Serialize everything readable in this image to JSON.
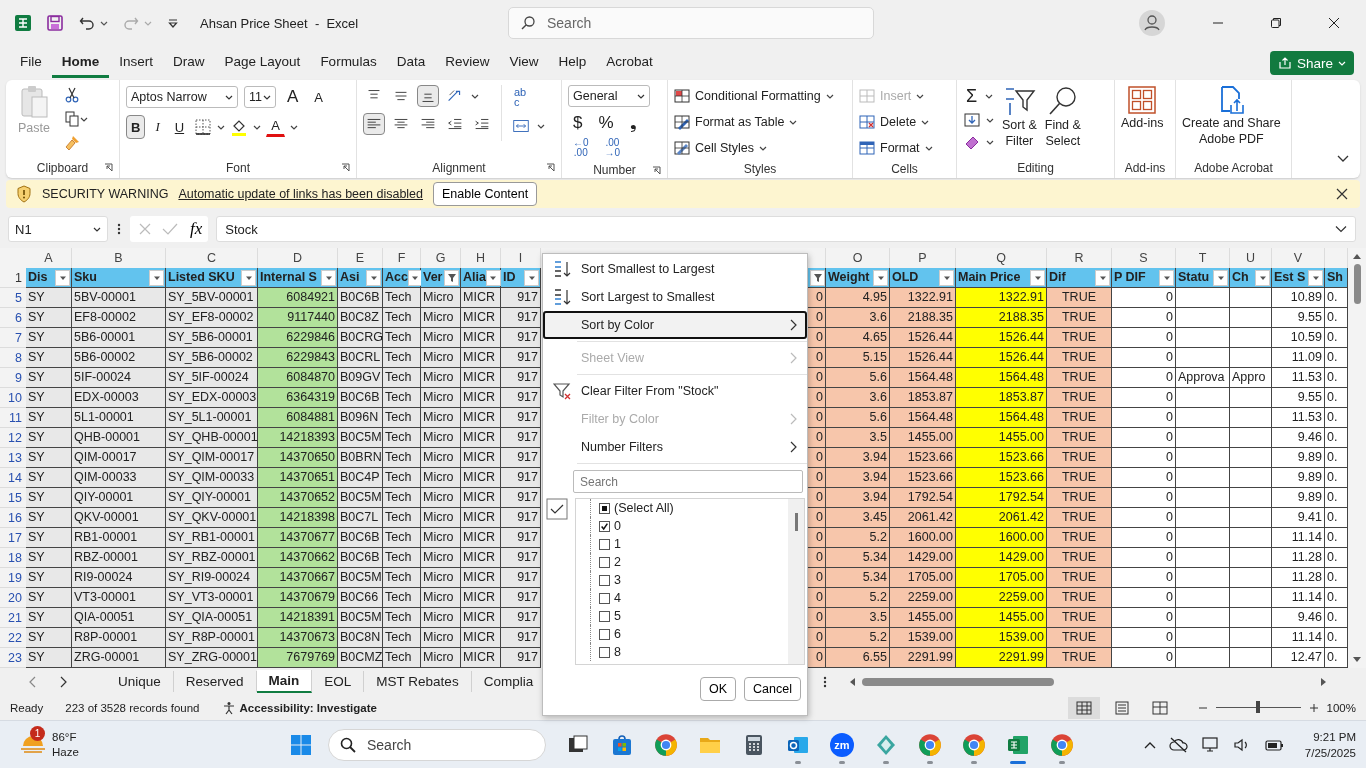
{
  "window": {
    "title": "Ahsan Price Sheet  -  Excel",
    "search_placeholder": "Search"
  },
  "ribbon_tabs": [
    {
      "label": "File",
      "selected": false
    },
    {
      "label": "Home",
      "selected": true
    },
    {
      "label": "Insert",
      "selected": false
    },
    {
      "label": "Draw",
      "selected": false
    },
    {
      "label": "Page Layout",
      "selected": false
    },
    {
      "label": "Formulas",
      "selected": false
    },
    {
      "label": "Data",
      "selected": false
    },
    {
      "label": "Review",
      "selected": false
    },
    {
      "label": "View",
      "selected": false
    },
    {
      "label": "Help",
      "selected": false
    },
    {
      "label": "Acrobat",
      "selected": false
    }
  ],
  "share_button": "Share",
  "clipboard": {
    "paste": "Paste",
    "label": "Clipboard"
  },
  "font": {
    "family": "Aptos Narrow",
    "size": "11",
    "grow": "A",
    "shrink": "A",
    "styles": [
      {
        "label": "B",
        "kind": "bold",
        "on": true
      },
      {
        "label": "I",
        "kind": "italic",
        "on": false
      },
      {
        "label": "U",
        "kind": "underline",
        "on": false
      }
    ],
    "font_color": "A",
    "label": "Font"
  },
  "alignment": {
    "vertical": [
      {
        "kind": "top",
        "on": false
      },
      {
        "kind": "middle",
        "on": false
      },
      {
        "kind": "bottom",
        "on": true
      }
    ],
    "horizontal": [
      {
        "kind": "left",
        "on": true
      },
      {
        "kind": "center",
        "on": false
      },
      {
        "kind": "right",
        "on": false
      }
    ],
    "wrap_top": "ab",
    "wrap_bottom": "c",
    "label": "Alignment"
  },
  "number": {
    "format": "General",
    "symbols": [
      "$",
      "%",
      "❟"
    ],
    "decimals": [
      {
        "top": "←0",
        "bottom": ".00"
      },
      {
        "top": ".00",
        "bottom": "→0"
      }
    ],
    "label": "Number"
  },
  "styles": {
    "items": [
      {
        "label": "Conditional Formatting",
        "kind": "conditional"
      },
      {
        "label": "Format as Table",
        "kind": "table"
      },
      {
        "label": "Cell Styles",
        "kind": "cell"
      }
    ],
    "label": "Styles"
  },
  "cells": {
    "items": [
      {
        "label": "Insert",
        "kind": "insert",
        "disabled": true
      },
      {
        "label": "Delete",
        "kind": "delete",
        "disabled": false
      },
      {
        "label": "Format",
        "kind": "format",
        "disabled": false
      }
    ],
    "label": "Cells"
  },
  "editing": {
    "autosum": "Σ",
    "sort_filter": [
      "Sort &",
      "Filter"
    ],
    "find_select": [
      "Find &",
      "Select"
    ],
    "label": "Editing"
  },
  "addins": {
    "button": "Add-ins",
    "label": "Add-ins"
  },
  "acrobat": {
    "button": [
      "Create and Share",
      "Adobe PDF"
    ],
    "label": "Adobe Acrobat"
  },
  "security_bar": {
    "title": "SECURITY WARNING",
    "message": "Automatic update of links has been disabled",
    "button": "Enable Content"
  },
  "formula_bar": {
    "name_box": "N1",
    "fx": "fx",
    "value": "Stock"
  },
  "sheet": {
    "header_row_number": "1",
    "columns": [
      {
        "letter": "A",
        "header": "Dis",
        "kind": "text",
        "color": "#e8e8e8",
        "filtered": false
      },
      {
        "letter": "B",
        "header": "Sku",
        "kind": "text",
        "color": "#e8e8e8",
        "filtered": false
      },
      {
        "letter": "C",
        "header": "Listed SKU",
        "kind": "text",
        "color": "#e8e8e8",
        "filtered": false
      },
      {
        "letter": "D",
        "header": "Internal S",
        "kind": "number",
        "color": "#b2e29b",
        "filtered": false
      },
      {
        "letter": "E",
        "header": "Asi",
        "kind": "text",
        "color": "#e8e8e8",
        "filtered": false
      },
      {
        "letter": "F",
        "header": "Acc",
        "kind": "text",
        "color": "#e8e8e8",
        "filtered": false
      },
      {
        "letter": "G",
        "header": "Ver",
        "kind": "text",
        "color": "#e8e8e8",
        "filtered": true
      },
      {
        "letter": "H",
        "header": "Alia",
        "kind": "text",
        "color": "#e8e8e8",
        "filtered": false
      },
      {
        "letter": "I",
        "header": "ID",
        "kind": "number",
        "color": "#e8e8e8",
        "filtered": false
      },
      {
        "kind": "number",
        "color": "#f7c6ab",
        "filtered": true
      },
      {
        "letter": "O",
        "header": "Weight",
        "kind": "number",
        "color": "#f7c6ab",
        "filtered": false
      },
      {
        "letter": "P",
        "header": "OLD",
        "kind": "number",
        "color": "#f7c6ab",
        "filtered": false
      },
      {
        "letter": "Q",
        "header": "Main Price",
        "kind": "number",
        "color": "#ffff00",
        "filtered": false
      },
      {
        "letter": "R",
        "header": "Dif",
        "kind": "bool",
        "color": "#f7c6ab",
        "filtered": false
      },
      {
        "letter": "S",
        "header": "P DIF",
        "kind": "number",
        "color": "#ffffff",
        "filtered": false
      },
      {
        "letter": "T",
        "header": "Statu",
        "kind": "text",
        "color": "#ffffff",
        "filtered": false
      },
      {
        "letter": "U",
        "header": "Ch",
        "kind": "text",
        "color": "#ffffff",
        "filtered": false
      },
      {
        "letter": "V",
        "header": "Est S",
        "kind": "number",
        "color": "#ffffff",
        "filtered": false
      },
      {
        "header": "Sh",
        "kind": "text",
        "color": "#ffffff"
      }
    ],
    "rows": [
      {
        "number": "5",
        "cells": [
          "SY",
          "5BV-00001",
          "SY_5BV-00001",
          "6084921",
          "B0C6B",
          "Tech",
          "Micro",
          "MICR",
          "917",
          "0",
          "4.95",
          "1322.91",
          "1322.91",
          "TRUE",
          "0",
          null,
          null,
          "10.89",
          "0."
        ]
      },
      {
        "number": "6",
        "cells": [
          "SY",
          "EF8-00002",
          "SY_EF8-00002",
          "9117440",
          "B0C8Z",
          "Tech",
          "Micro",
          "MICR",
          "917",
          "0",
          "3.6",
          "2188.35",
          "2188.35",
          "TRUE",
          "0",
          null,
          null,
          "9.55",
          "0."
        ]
      },
      {
        "number": "7",
        "cells": [
          "SY",
          "5B6-00001",
          "SY_5B6-00001",
          "6229846",
          "B0CRG",
          "Tech",
          "Micro",
          "MICR",
          "917",
          "0",
          "4.65",
          "1526.44",
          "1526.44",
          "TRUE",
          "0",
          null,
          null,
          "10.59",
          "0."
        ]
      },
      {
        "number": "8",
        "cells": [
          "SY",
          "5B6-00002",
          "SY_5B6-00002",
          "6229843",
          "B0CRL",
          "Tech",
          "Micro",
          "MICR",
          "917",
          "0",
          "5.15",
          "1526.44",
          "1526.44",
          "TRUE",
          "0",
          null,
          null,
          "11.09",
          "0."
        ]
      },
      {
        "number": "9",
        "cells": [
          "SY",
          "5IF-00024",
          "SY_5IF-00024",
          "6084870",
          "B09GV",
          "Tech",
          "Micro",
          "MICR",
          "917",
          "0",
          "5.6",
          "1564.48",
          "1564.48",
          "TRUE",
          "0",
          "Approva",
          "Appro",
          "11.53",
          "0."
        ]
      },
      {
        "number": "10",
        "cells": [
          "SY",
          "EDX-00003",
          "SY_EDX-00003",
          "6364319",
          "B0C6B",
          "Tech",
          "Micro",
          "MICR",
          "917",
          "0",
          "3.6",
          "1853.87",
          "1853.87",
          "TRUE",
          "0",
          null,
          null,
          "9.55",
          "0."
        ]
      },
      {
        "number": "11",
        "cells": [
          "SY",
          "5L1-00001",
          "SY_5L1-00001",
          "6084881",
          "B096N",
          "Tech",
          "Micro",
          "MICR",
          "917",
          "0",
          "5.6",
          "1564.48",
          "1564.48",
          "TRUE",
          "0",
          null,
          null,
          "11.53",
          "0."
        ]
      },
      {
        "number": "12",
        "cells": [
          "SY",
          "QHB-00001",
          "SY_QHB-00001",
          "14218393",
          "B0C5M",
          "Tech",
          "Micro",
          "MICR",
          "917",
          "0",
          "3.5",
          "1455.00",
          "1455.00",
          "TRUE",
          "0",
          null,
          null,
          "9.46",
          "0."
        ]
      },
      {
        "number": "13",
        "cells": [
          "SY",
          "QIM-00017",
          "SY_QIM-00017",
          "14370650",
          "B0BRN",
          "Tech",
          "Micro",
          "MICR",
          "917",
          "0",
          "3.94",
          "1523.66",
          "1523.66",
          "TRUE",
          "0",
          null,
          null,
          "9.89",
          "0."
        ]
      },
      {
        "number": "14",
        "cells": [
          "SY",
          "QIM-00033",
          "SY_QIM-00033",
          "14370651",
          "B0C4P",
          "Tech",
          "Micro",
          "MICR",
          "917",
          "0",
          "3.94",
          "1523.66",
          "1523.66",
          "TRUE",
          "0",
          null,
          null,
          "9.89",
          "0."
        ]
      },
      {
        "number": "15",
        "cells": [
          "SY",
          "QIY-00001",
          "SY_QIY-00001",
          "14370652",
          "B0C5M",
          "Tech",
          "Micro",
          "MICR",
          "917",
          "0",
          "3.94",
          "1792.54",
          "1792.54",
          "TRUE",
          "0",
          null,
          null,
          "9.89",
          "0."
        ]
      },
      {
        "number": "16",
        "cells": [
          "SY",
          "QKV-00001",
          "SY_QKV-00001",
          "14218398",
          "B0C7L",
          "Tech",
          "Micro",
          "MICR",
          "917",
          "0",
          "3.45",
          "2061.42",
          "2061.42",
          "TRUE",
          "0",
          null,
          null,
          "9.41",
          "0."
        ]
      },
      {
        "number": "17",
        "cells": [
          "SY",
          "RB1-00001",
          "SY_RB1-00001",
          "14370677",
          "B0C6B",
          "Tech",
          "Micro",
          "MICR",
          "917",
          "0",
          "5.2",
          "1600.00",
          "1600.00",
          "TRUE",
          "0",
          null,
          null,
          "11.14",
          "0."
        ]
      },
      {
        "number": "18",
        "cells": [
          "SY",
          "RBZ-00001",
          "SY_RBZ-00001",
          "14370662",
          "B0C6B",
          "Tech",
          "Micro",
          "MICR",
          "917",
          "0",
          "5.34",
          "1429.00",
          "1429.00",
          "TRUE",
          "0",
          null,
          null,
          "11.28",
          "0."
        ]
      },
      {
        "number": "19",
        "cells": [
          "SY",
          "RI9-00024",
          "SY_RI9-00024",
          "14370667",
          "B0C5M",
          "Tech",
          "Micro",
          "MICR",
          "917",
          "0",
          "5.34",
          "1705.00",
          "1705.00",
          "TRUE",
          "0",
          null,
          null,
          "11.28",
          "0."
        ]
      },
      {
        "number": "20",
        "cells": [
          "SY",
          "VT3-00001",
          "SY_VT3-00001",
          "14370679",
          "B0C66",
          "Tech",
          "Micro",
          "MICR",
          "917",
          "0",
          "5.2",
          "2259.00",
          "2259.00",
          "TRUE",
          "0",
          null,
          null,
          "11.14",
          "0."
        ]
      },
      {
        "number": "21",
        "cells": [
          "SY",
          "QIA-00051",
          "SY_QIA-00051",
          "14218391",
          "B0C5M",
          "Tech",
          "Micro",
          "MICR",
          "917",
          "0",
          "3.5",
          "1455.00",
          "1455.00",
          "TRUE",
          "0",
          null,
          null,
          "9.46",
          "0."
        ]
      },
      {
        "number": "22",
        "cells": [
          "SY",
          "R8P-00001",
          "SY_R8P-00001",
          "14370673",
          "B0C8N",
          "Tech",
          "Micro",
          "MICR",
          "917",
          "0",
          "5.2",
          "1539.00",
          "1539.00",
          "TRUE",
          "0",
          null,
          null,
          "11.14",
          "0."
        ]
      },
      {
        "number": "23",
        "cells": [
          "SY",
          "ZRG-00001",
          "SY_ZRG-00001",
          "7679769",
          "B0CMZ",
          "Tech",
          "Micro",
          "MICR",
          "917",
          "0",
          "6.55",
          "2291.99",
          "2291.99",
          "TRUE",
          "0",
          null,
          null,
          "12.47",
          "0."
        ]
      }
    ]
  },
  "filter_menu": {
    "groups": [
      [
        {
          "label": "Sort Smallest to Largest",
          "kind": "sort-asc",
          "disabled": false,
          "submenu": false,
          "selected": false
        },
        {
          "label": "Sort Largest to Smallest",
          "kind": "sort-desc",
          "disabled": false,
          "submenu": false,
          "selected": false
        },
        {
          "label": "Sort by Color",
          "kind": "plain",
          "disabled": false,
          "submenu": true,
          "selected": true
        }
      ],
      [
        {
          "label": "Sheet View",
          "kind": "plain",
          "disabled": true,
          "submenu": true,
          "selected": false
        }
      ],
      [
        {
          "label": "Clear Filter From \"Stock\"",
          "kind": "clear-filter",
          "disabled": false,
          "submenu": false,
          "selected": false
        },
        {
          "label": "Filter by Color",
          "kind": "plain",
          "disabled": true,
          "submenu": true,
          "selected": false
        },
        {
          "label": "Number Filters",
          "kind": "plain",
          "disabled": false,
          "submenu": true,
          "selected": false
        }
      ]
    ],
    "search_placeholder": "Search",
    "values": [
      {
        "label": "(Select All)",
        "checked": false,
        "partial": true
      },
      {
        "label": "0",
        "checked": true,
        "partial": false
      },
      {
        "label": "1",
        "checked": false,
        "partial": false
      },
      {
        "label": "2",
        "checked": false,
        "partial": false
      },
      {
        "label": "3",
        "checked": false,
        "partial": false
      },
      {
        "label": "4",
        "checked": false,
        "partial": false
      },
      {
        "label": "5",
        "checked": false,
        "partial": false
      },
      {
        "label": "6",
        "checked": false,
        "partial": false
      },
      {
        "label": "8",
        "checked": false,
        "partial": false
      }
    ],
    "ok": "OK",
    "cancel": "Cancel"
  },
  "sheet_tabs": [
    {
      "label": "Unique",
      "selected": false
    },
    {
      "label": "Reserved",
      "selected": false
    },
    {
      "label": "Main",
      "selected": true
    },
    {
      "label": "EOL",
      "selected": false
    },
    {
      "label": "MST Rebates",
      "selected": false
    },
    {
      "label": "Complia",
      "selected": false
    }
  ],
  "status_bar": {
    "mode": "Ready",
    "records": "223 of 3528 records found",
    "accessibility": "Accessibility: Investigate",
    "views": [
      {
        "kind": "normal",
        "selected": true
      },
      {
        "kind": "page-layout",
        "selected": false
      },
      {
        "kind": "page-break",
        "selected": false
      }
    ],
    "zoom": {
      "level": 0.5,
      "reading": "100%"
    }
  },
  "taskbar": {
    "weather": {
      "badge": "1",
      "temperature": "86°F",
      "condition": "Haze"
    },
    "search_placeholder": "Search",
    "apps": [
      {
        "kind": "task-view",
        "running": false
      },
      {
        "kind": "store",
        "running": false
      },
      {
        "kind": "chrome",
        "running": false
      },
      {
        "kind": "folder",
        "running": false
      },
      {
        "kind": "calculator",
        "running": false
      },
      {
        "kind": "outlook",
        "running": true
      },
      {
        "kind": "zoom",
        "label": "zm",
        "running": true
      },
      {
        "kind": "diamond",
        "running": true
      },
      {
        "kind": "chrome",
        "running": true
      },
      {
        "kind": "chrome",
        "running": true
      },
      {
        "kind": "excel",
        "running": true
      },
      {
        "kind": "chrome",
        "running": true
      }
    ],
    "time": "9:21 PM",
    "date": "7/25/2025"
  }
}
